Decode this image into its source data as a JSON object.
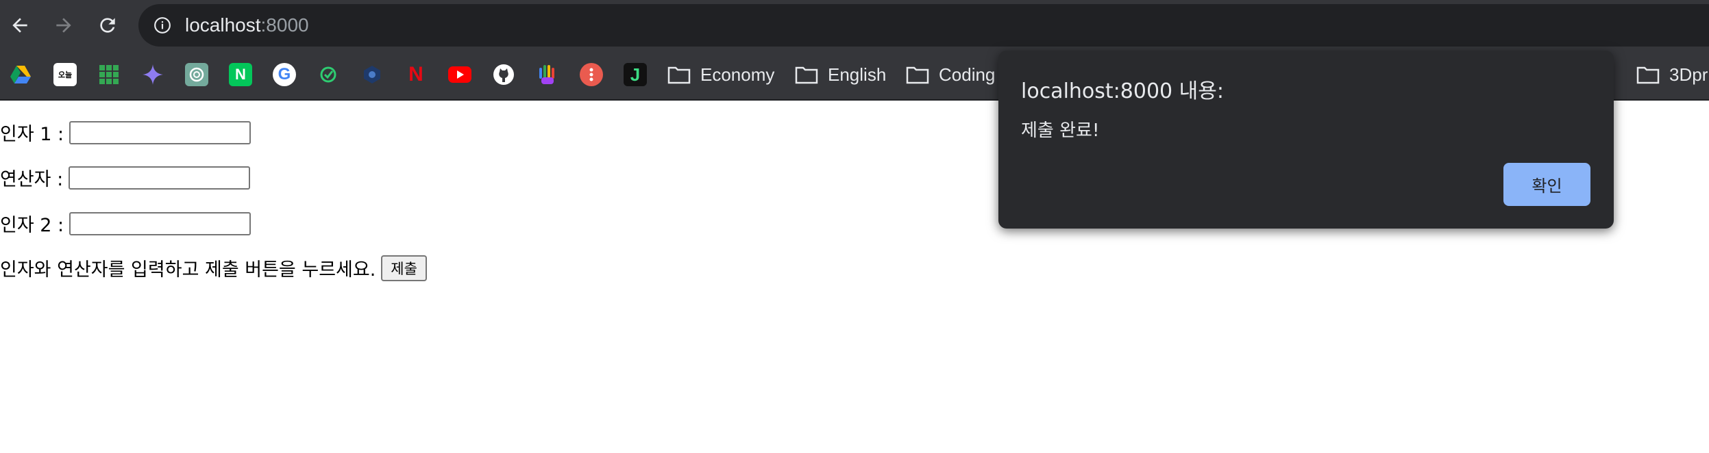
{
  "browser": {
    "url_host": "localhost",
    "url_port": ":8000",
    "bookmarks": [
      {
        "icon": "google-drive-icon"
      },
      {
        "icon": "calendar-icon",
        "text": "오늘"
      },
      {
        "icon": "apps-grid-icon"
      },
      {
        "icon": "gemini-icon"
      },
      {
        "icon": "chatgpt-icon"
      },
      {
        "icon": "naver-icon",
        "text": "N"
      },
      {
        "icon": "google-icon",
        "text": "G"
      },
      {
        "icon": "green-app-icon"
      },
      {
        "icon": "blue-app-icon"
      },
      {
        "icon": "netflix-icon",
        "text": "N"
      },
      {
        "icon": "youtube-icon"
      },
      {
        "icon": "github-icon"
      },
      {
        "icon": "colorful-hand-icon"
      },
      {
        "icon": "red-dots-icon"
      },
      {
        "icon": "j-app-icon",
        "text": "J"
      }
    ],
    "folders": [
      "Economy",
      "English",
      "Coding",
      "3Dpr"
    ]
  },
  "form": {
    "operand1_label": "인자 1 :",
    "operator_label": "연산자 :",
    "operand2_label": "인자 2 :",
    "operand1_value": "",
    "operator_value": "",
    "operand2_value": "",
    "instruction": "인자와 연산자를 입력하고 제출 버튼을 누르세요.",
    "submit_label": "제출"
  },
  "dialog": {
    "title": "localhost:8000 내용:",
    "message": "제출 완료!",
    "ok_label": "확인"
  },
  "colors": {
    "chrome_bg": "#35363a",
    "omnibox_bg": "#202124",
    "dialog_bg": "#292a2d",
    "accent_button": "#8ab4f8"
  }
}
